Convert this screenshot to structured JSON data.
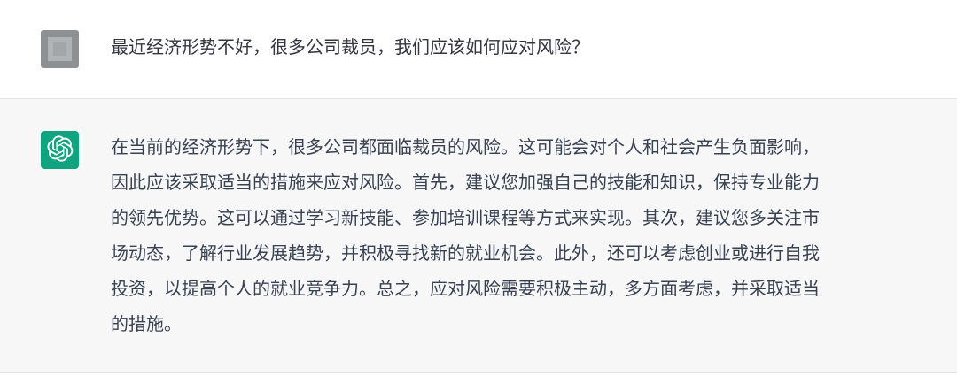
{
  "user_message": {
    "avatar": "blurred-user-avatar",
    "text": "最近经济形势不好，很多公司裁员，我们应该如何应对风险？"
  },
  "assistant_message": {
    "avatar": "openai-logo-icon",
    "brand_color": "#10a37f",
    "lines": [
      "在当前的经济形势下，很多公司都面临裁员的风险。这可能会对个人和社会产生负面影响，",
      "因此应该采取适当的措施来应对风险。首先，建议您加强自己的技能和知识，保持专业能力",
      "的领先优势。这可以通过学习新技能、参加培训课程等方式来实现。其次，建议您多关注市",
      "场动态，了解行业发展趋势，并积极寻找新的就业机会。此外，还可以考虑创业或进行自我",
      "投资，以提高个人的就业竞争力。总之，应对风险需要积极主动，多方面考虑，并采取适当",
      "的措施。"
    ]
  },
  "colors": {
    "user_row_bg": "#ffffff",
    "assistant_row_bg": "#f7f7f8",
    "text": "#374151"
  }
}
